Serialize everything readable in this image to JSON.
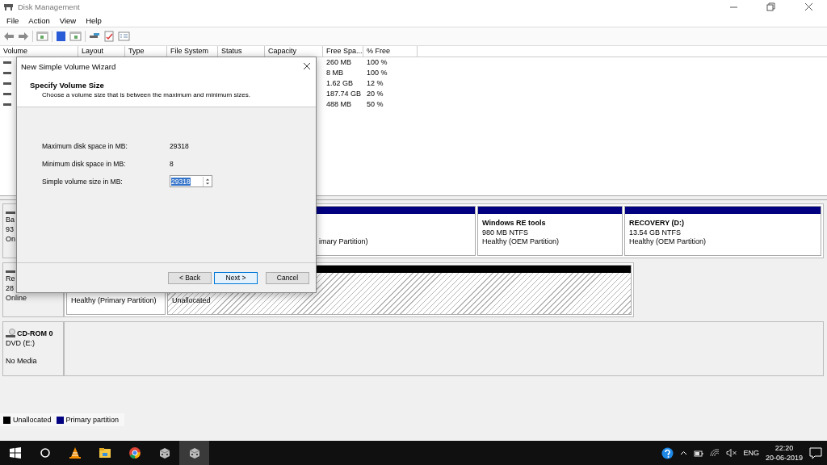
{
  "window": {
    "title": "Disk Management"
  },
  "menu": [
    "File",
    "Action",
    "View",
    "Help"
  ],
  "volume_table": {
    "columns": [
      "Volume",
      "Layout",
      "Type",
      "File System",
      "Status",
      "Capacity",
      "Free Spa...",
      "% Free"
    ],
    "rows": [
      {
        "free_space": "260 MB",
        "percent_free": "100 %"
      },
      {
        "free_space": "8 MB",
        "percent_free": "100 %"
      },
      {
        "free_space": "1.62 GB",
        "percent_free": "12 %"
      },
      {
        "free_space": "187.74 GB",
        "percent_free": "20 %"
      },
      {
        "free_space": "488 MB",
        "percent_free": "50 %"
      }
    ]
  },
  "disks": [
    {
      "kind": "disk",
      "info": [
        "Ba",
        "93",
        "On"
      ],
      "partitions": [
        {
          "kind": "primary",
          "status": "imary Partition)"
        },
        {
          "kind": "primary",
          "name": "Windows RE tools",
          "detail": "980 MB NTFS",
          "status": "Healthy (OEM Partition)"
        },
        {
          "kind": "primary",
          "name": "RECOVERY  (D:)",
          "detail": "13.54 GB NTFS",
          "status": "Healthy (OEM Partition)"
        }
      ]
    },
    {
      "kind": "disk",
      "info": [
        "Re",
        "28",
        "Online"
      ],
      "partitions": [
        {
          "kind": "primary",
          "status": "Healthy (Primary Partition)"
        },
        {
          "kind": "unallocated",
          "status": "Unallocated"
        }
      ]
    },
    {
      "kind": "cdrom",
      "name": "CD-ROM 0",
      "info": [
        "DVD (E:)",
        "No Media"
      ]
    }
  ],
  "legend": [
    {
      "label": "Unallocated",
      "color": "#000000"
    },
    {
      "label": "Primary partition",
      "color": "#000080"
    }
  ],
  "dialog": {
    "title": "New Simple Volume Wizard",
    "heading": "Specify Volume Size",
    "subtitle": "Choose a volume size that is between the maximum and minimum sizes.",
    "fields": [
      {
        "kind": "text",
        "label": "Maximum disk space in MB:",
        "value": "29318"
      },
      {
        "kind": "text",
        "label": "Minimum disk space in MB:",
        "value": "8"
      },
      {
        "kind": "spinner",
        "label": "Simple volume size in MB:",
        "value": "29318",
        "text_selected": true
      }
    ],
    "buttons": [
      {
        "label": "< Back",
        "focused": false
      },
      {
        "label": "Next >",
        "focused": true
      },
      {
        "label": "Cancel",
        "focused": false
      }
    ]
  },
  "taskbar": {
    "apps": [
      {
        "kind": "cone",
        "active": false
      },
      {
        "kind": "folder",
        "active": false
      },
      {
        "kind": "browser",
        "active": false
      },
      {
        "kind": "disk",
        "active": false
      },
      {
        "kind": "disk",
        "active": true
      }
    ],
    "language": "ENG",
    "time": "22:20",
    "date": "20-06-2019"
  }
}
